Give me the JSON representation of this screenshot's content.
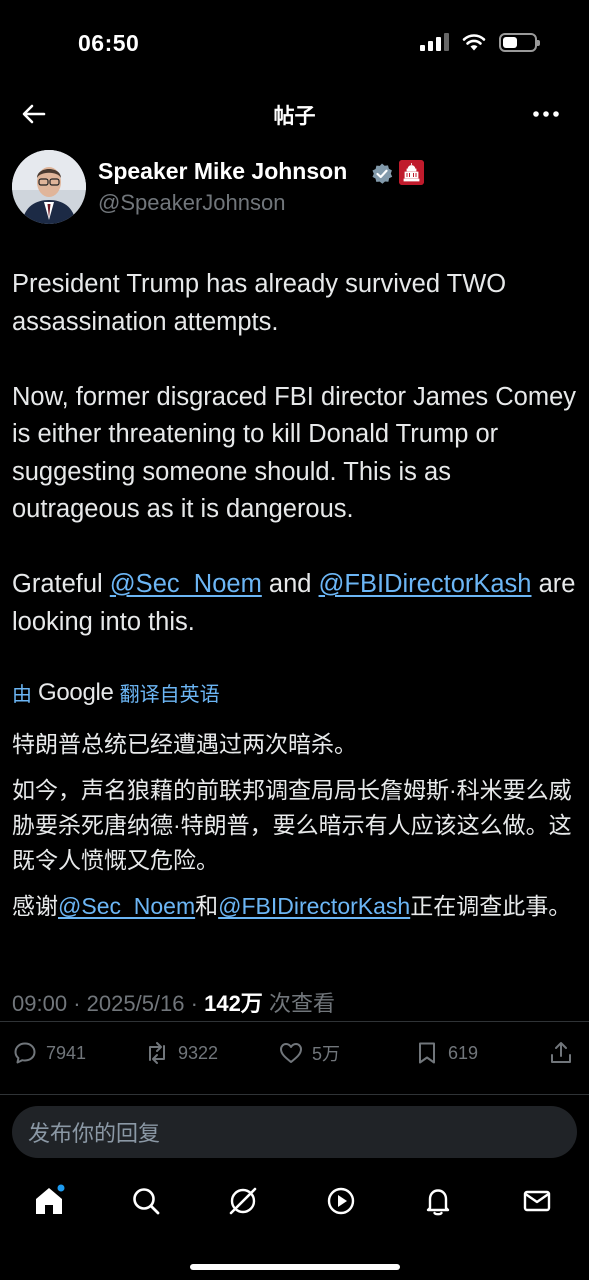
{
  "status_bar": {
    "time": "06:50"
  },
  "header": {
    "title": "帖子"
  },
  "author": {
    "name": "Speaker Mike Johnson",
    "handle": "@SpeakerJohnson"
  },
  "tweet": {
    "paragraph1": "President Trump has already survived TWO assassination attempts.",
    "paragraph2": "Now, former disgraced FBI director James Comey is either threatening to kill Donald Trump or suggesting someone should. This is as outrageous as it is dangerous.",
    "paragraph3_prefix": "Grateful ",
    "mention1": "@Sec_Noem",
    "paragraph3_and": " and ",
    "mention2": "@FBIDirectorKash",
    "paragraph3_suffix": " are looking into this."
  },
  "translation": {
    "by_prefix": "由",
    "google": "Google",
    "by_suffix": "翻译自英语",
    "line1": "特朗普总统已经遭遇过两次暗杀。",
    "line2": "如今，声名狼藉的前联邦调查局局长詹姆斯·科米要么威胁要杀死唐纳德·特朗普，要么暗示有人应该这么做。这既令人愤慨又危险。",
    "line3_prefix": "感谢",
    "mention1": "@Sec_Noem",
    "line3_and": "和",
    "mention2": "@FBIDirectorKash",
    "line3_suffix": "正在调查此事。"
  },
  "meta": {
    "time": "09:00",
    "date": "2025/5/16",
    "views": "142万",
    "views_label": "次查看",
    "separator": "·"
  },
  "actions": {
    "replies": "7941",
    "reposts": "9322",
    "likes": "5万",
    "bookmarks": "619"
  },
  "reply": {
    "placeholder": "发布你的回复"
  },
  "colors": {
    "background": "#000000",
    "text": "#e7e9ea",
    "secondary": "#71767b",
    "link": "#6cb6f5",
    "accent": "#1d9bf0",
    "affiliation_badge": "#c01b2c"
  },
  "icons": {
    "back": "arrow-left-icon",
    "more": "more-horizontal-icon",
    "verified": "verified-badge-icon",
    "affiliation": "capitol-badge-icon",
    "reply": "comment-icon",
    "repost": "repost-icon",
    "like": "heart-icon",
    "bookmark": "bookmark-icon",
    "share": "share-icon",
    "nav": [
      "home-icon",
      "search-icon",
      "grok-icon",
      "play-icon",
      "bell-icon",
      "mail-icon"
    ]
  }
}
